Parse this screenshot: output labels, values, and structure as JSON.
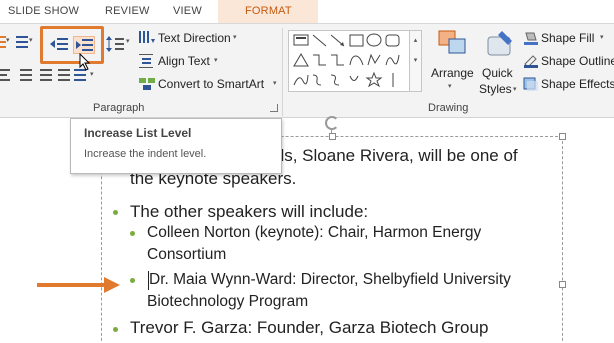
{
  "tabs": [
    {
      "label": "SLIDE SHOW"
    },
    {
      "label": "REVIEW"
    },
    {
      "label": "VIEW"
    },
    {
      "label": "FORMAT"
    }
  ],
  "ribbon": {
    "paragraph": {
      "group_label": "Paragraph",
      "text_direction_label": "Text Direction",
      "align_text_label": "Align Text",
      "convert_smartart_label": "Convert to SmartArt"
    },
    "drawing": {
      "group_label": "Drawing",
      "arrange_label": "Arrange",
      "quick_styles_label_1": "Quick",
      "quick_styles_label_2": "Styles",
      "shape_fill_label": "Shape Fill",
      "shape_outline_label": "Shape Outline",
      "shape_effects_label": "Shape Effects"
    }
  },
  "tooltip": {
    "title": "Increase List Level",
    "description": "Increase the indent level."
  },
  "slide": {
    "line1_tail": "els, Sloane Rivera, will be one of",
    "line2": "the keynote speakers.",
    "bullet1": "The other speakers will include:",
    "sub1_line1": "Colleen Norton (keynote): Chair, Harmon Energy",
    "sub1_line2": "Consortium",
    "sub2_line1": "Dr. Maia Wynn-Ward: Director, Shelbyfield University",
    "sub2_line2": "Biotechnology Program",
    "bullet2": "Trevor F. Garza: Founder, Garza Biotech Group"
  },
  "colors": {
    "accent_orange": "#e07a2f",
    "bullet_green": "#7aab3f",
    "format_tab_bg": "#fbe7d8",
    "format_tab_text": "#c55a11"
  }
}
